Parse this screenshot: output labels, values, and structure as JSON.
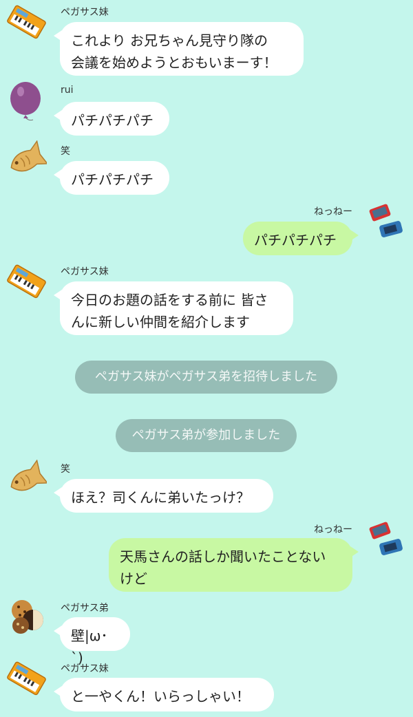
{
  "senders": {
    "pegasus_sister": "ペガサス妹",
    "rui": "rui",
    "warai": "笑",
    "nenne": "ねっねー",
    "pegasus_brother": "ペガサス弟"
  },
  "messages": [
    {
      "sender": "ペガサス妹",
      "text": "これより お兄ちゃん見守り隊の\n会議を始めようとおもいまーす！"
    },
    {
      "sender": "rui",
      "text": "パチパチパチ"
    },
    {
      "sender": "笑",
      "text": "パチパチパチ"
    },
    {
      "sender": "ねっねー",
      "text": "パチパチパチ"
    },
    {
      "sender": "ペガサス妹",
      "text": "今日のお題の話をする前に 皆さ\nんに新しい仲間を紹介します"
    },
    {
      "system": "ペガサス妹がペガサス弟を招待しました"
    },
    {
      "system": "ペガサス弟が参加しました"
    },
    {
      "sender": "笑",
      "text": "ほえ？司くんに弟いたっけ？"
    },
    {
      "sender": "ねっねー",
      "text": "天馬さんの話しか聞いたことない\nけど"
    },
    {
      "sender": "ペガサス弟",
      "text": "壁|ω･`)"
    },
    {
      "sender": "ペガサス妹",
      "text": "と一やくん！いらっしゃい！"
    }
  ],
  "colors": {
    "background": "#c4f6ec",
    "incoming_bubble": "#ffffff",
    "outgoing_bubble": "#c8f8a3",
    "system_pill": "#96bdb6"
  },
  "avatars": {
    "pegasus_sister": "keyboard-icon",
    "rui": "balloon-icon",
    "warai": "taiyaki-icon",
    "nenne": "game-console-icon",
    "pegasus_brother": "cookies-icon"
  }
}
